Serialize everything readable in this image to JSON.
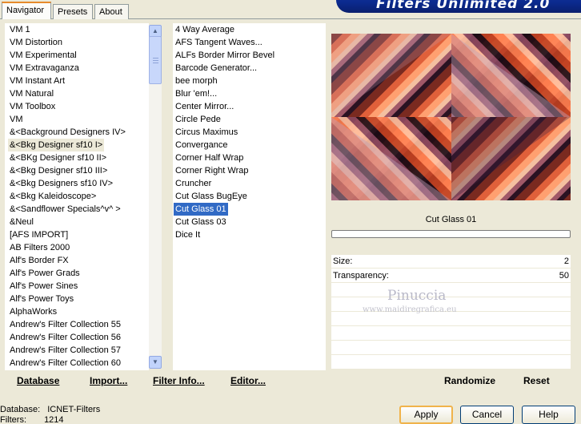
{
  "tabs": [
    {
      "label": "Navigator",
      "active": true
    },
    {
      "label": "Presets",
      "active": false
    },
    {
      "label": "About",
      "active": false
    }
  ],
  "banner": {
    "title": "Filters Unlimited 2.0"
  },
  "categories": {
    "items": [
      "VM 1",
      "VM Distortion",
      "VM Experimental",
      "VM Extravaganza",
      "VM Instant Art",
      "VM Natural",
      "VM Toolbox",
      "VM",
      "&<Background Designers IV>",
      "&<Bkg Designer sf10 I>",
      "&<BKg Designer sf10 II>",
      "&<Bkg Designer sf10 III>",
      "&<Bkg Designers sf10 IV>",
      "&<Bkg Kaleidoscope>",
      "&<Sandflower Specials^v^ >",
      "&Neul",
      "[AFS IMPORT]",
      "AB Filters 2000",
      "Alf's Border FX",
      "Alf's Power Grads",
      "Alf's Power Sines",
      "Alf's Power Toys",
      "AlphaWorks",
      "Andrew's Filter Collection 55",
      "Andrew's Filter Collection 56",
      "Andrew's Filter Collection 57",
      "Andrew's Filter Collection 60"
    ],
    "selected_index": 9
  },
  "filters": {
    "items": [
      "4 Way Average",
      "AFS Tangent Waves...",
      "ALFs Border Mirror Bevel",
      "Barcode Generator...",
      "bee morph",
      "Blur 'em!...",
      "Center Mirror...",
      "Circle Pede",
      "Circus Maximus",
      "Convergance",
      "Corner Half Wrap",
      "Corner Right Wrap",
      "Cruncher",
      "Cut Glass  BugEye",
      "Cut Glass 01",
      "Cut Glass 03",
      "Dice It"
    ],
    "selected_index": 14
  },
  "preview": {
    "filter_name": "Cut Glass 01",
    "progress": 0
  },
  "params": [
    {
      "label": "Size:",
      "value": "2"
    },
    {
      "label": "Transparency:",
      "value": "50"
    }
  ],
  "watermark": {
    "name": "Pinuccia",
    "site": "www.maidiregrafica.eu"
  },
  "bottom_buttons": {
    "database": "Database",
    "import": "Import...",
    "filter_info": "Filter Info...",
    "editor": "Editor...",
    "randomize": "Randomize",
    "reset": "Reset"
  },
  "dialog_buttons": {
    "apply": "Apply",
    "cancel": "Cancel",
    "help": "Help"
  },
  "status": {
    "database_label": "Database:",
    "database_value": "ICNET-Filters",
    "filters_label": "Filters:",
    "filters_value": "1214"
  },
  "colors": {
    "selection": "#316ac5",
    "panel_bg": "#ece9d8",
    "banner": "#0b2a8e"
  }
}
